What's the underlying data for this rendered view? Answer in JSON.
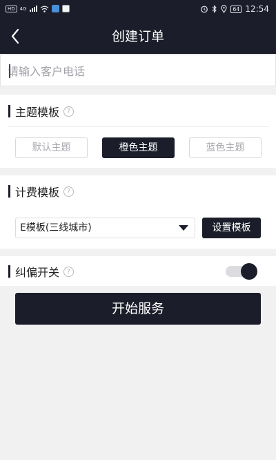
{
  "status_bar": {
    "hd_label": "HD",
    "network_type": "4G",
    "battery_level": "64",
    "time": "12:54",
    "icons": [
      "hd-icon",
      "signal-icon",
      "wifi-icon",
      "app-notification-icon",
      "app-notification-icon",
      "alarm-icon",
      "bluetooth-icon",
      "location-icon",
      "battery-icon"
    ]
  },
  "header": {
    "title": "创建订单",
    "back_icon": "chevron-left-icon"
  },
  "phone_input": {
    "placeholder": "请输入客户电话",
    "value": ""
  },
  "theme_section": {
    "title": "主题模板",
    "help_icon": "question-circle-icon",
    "help_glyph": "?",
    "options": [
      "默认主题",
      "橙色主题",
      "蓝色主题"
    ],
    "selected": "橙色主题"
  },
  "billing_section": {
    "title": "计费模板",
    "help_icon": "question-circle-icon",
    "help_glyph": "?",
    "selected_template": "E模板(三线城市)",
    "dropdown_icon": "caret-down-icon",
    "settings_button": "设置模板"
  },
  "deviation_section": {
    "title": "纠偏开关",
    "help_icon": "question-circle-icon",
    "help_glyph": "?",
    "toggle_on": true
  },
  "start_button": "开始服务",
  "colors": {
    "primary_dark": "#1b1d2a",
    "background": "#f1f1f1",
    "white": "#ffffff",
    "muted_text": "#a8a8b0"
  }
}
